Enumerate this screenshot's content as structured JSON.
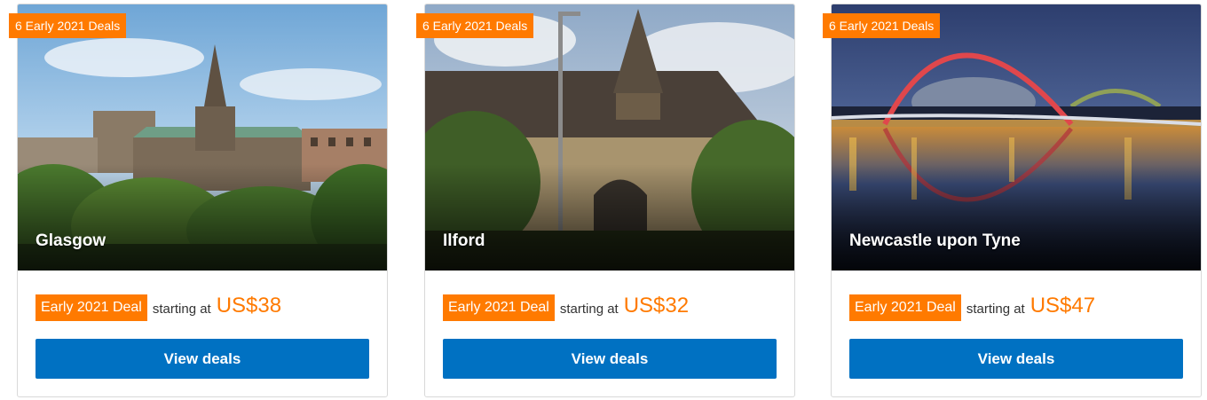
{
  "cards": [
    {
      "ribbon": "6 Early 2021 Deals",
      "city": "Glasgow",
      "deal_badge": "Early 2021 Deal",
      "starting_text": "starting at",
      "price": "US$38",
      "button_label": "View deals"
    },
    {
      "ribbon": "6 Early 2021 Deals",
      "city": "Ilford",
      "deal_badge": "Early 2021 Deal",
      "starting_text": "starting at",
      "price": "US$32",
      "button_label": "View deals"
    },
    {
      "ribbon": "6 Early 2021 Deals",
      "city": "Newcastle upon Tyne",
      "deal_badge": "Early 2021 Deal",
      "starting_text": "starting at",
      "price": "US$47",
      "button_label": "View deals"
    }
  ],
  "colors": {
    "accent_orange": "#ff7a00",
    "button_blue": "#0071c2",
    "text_dark": "#333333",
    "card_border": "#d9d9d9"
  }
}
